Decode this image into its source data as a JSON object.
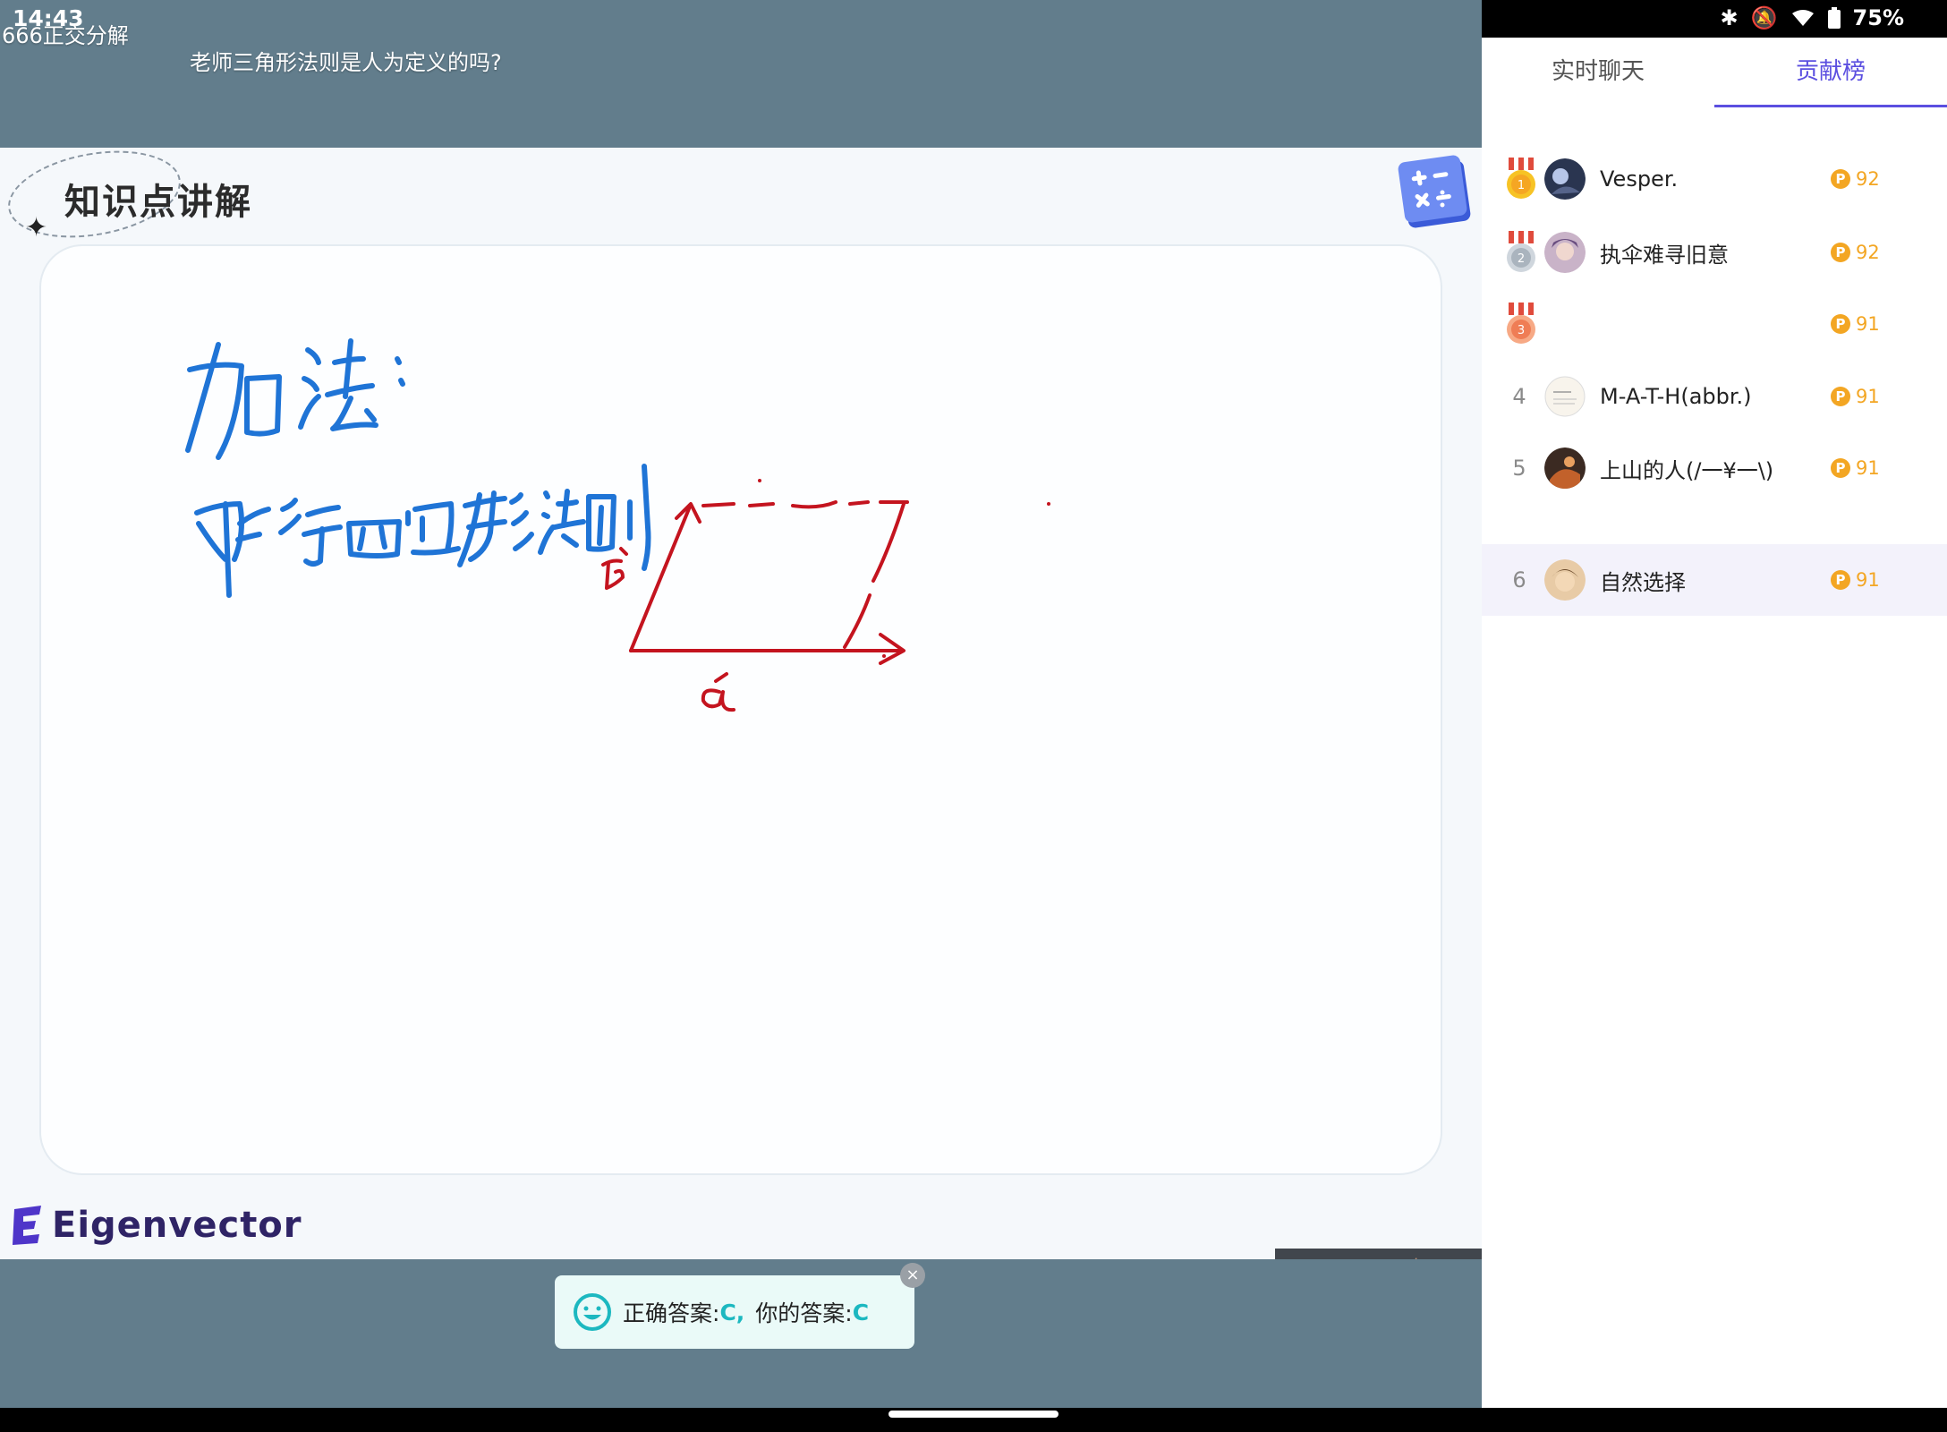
{
  "status_bar": {
    "time": "14:43",
    "battery": "75%",
    "icons": [
      "bluetooth-icon",
      "bell-off-icon",
      "wifi-icon",
      "battery-icon"
    ]
  },
  "danmaku": [
    {
      "text": "666正交分解"
    },
    {
      "text": "老师三角形法则是人为定义的吗?"
    }
  ],
  "slide": {
    "section_title": "知识点讲解",
    "logo_text": "Eigenvector"
  },
  "answer_toast": {
    "correct_label": "正确答案:",
    "correct_value": "C,",
    "yours_label": "你的答案:",
    "yours_value": "C"
  },
  "panel": {
    "tabs": [
      {
        "label": "实时聊天",
        "active": false
      },
      {
        "label": "贡献榜",
        "active": true
      }
    ],
    "leaderboard": [
      {
        "rank": "1",
        "name": "Vesper.",
        "coins": "92",
        "medal": "gold"
      },
      {
        "rank": "2",
        "name": "执伞难寻旧意",
        "coins": "92",
        "medal": "silver"
      },
      {
        "rank": "3",
        "name": "",
        "coins": "91",
        "medal": "bronze"
      },
      {
        "rank": "4",
        "name": "M-A-T-H(abbr.)",
        "coins": "91",
        "medal": ""
      },
      {
        "rank": "5",
        "name": "上山的人(/一¥一\\)",
        "coins": "91",
        "medal": ""
      }
    ],
    "self_entry": {
      "rank": "6",
      "name": "自然选择",
      "coins": "91"
    }
  },
  "colors": {
    "accent": "#5b4fe0",
    "coin": "#f3a623",
    "video_bg": "#627d8c",
    "answer_teal": "#1cb8c0"
  }
}
